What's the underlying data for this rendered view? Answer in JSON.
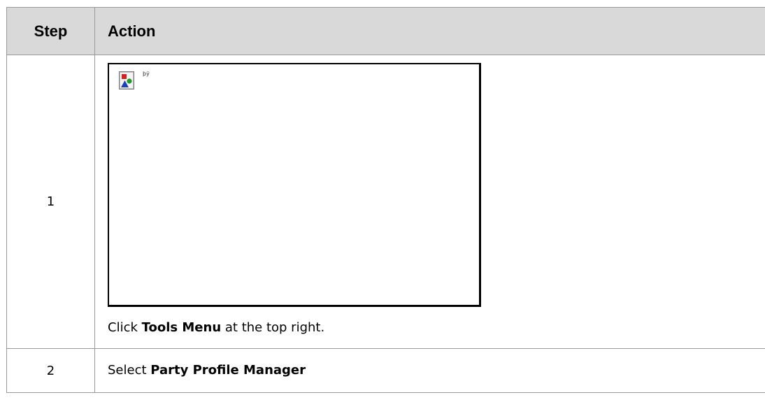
{
  "table": {
    "headers": {
      "step": "Step",
      "action": "Action"
    },
    "rows": [
      {
        "step": "1",
        "image": {
          "icon": "broken-image-icon",
          "alt_text": "þÿ"
        },
        "instruction": {
          "prefix": "Click ",
          "bold": "Tools Menu",
          "suffix": " at the top right."
        }
      },
      {
        "step": "2",
        "instruction": {
          "prefix": "Select ",
          "bold": "Party Profile Manager"
        }
      }
    ]
  }
}
